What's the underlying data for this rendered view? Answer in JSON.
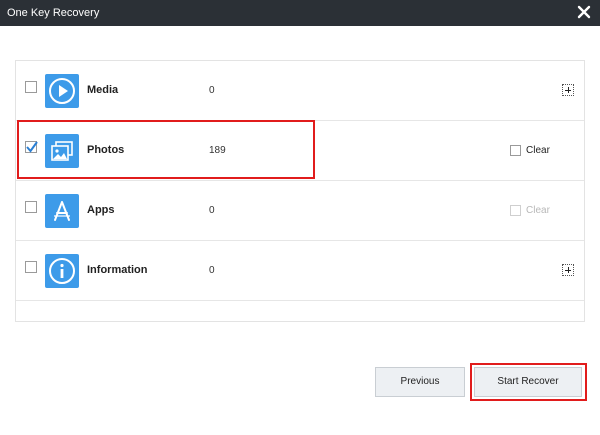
{
  "window": {
    "title": "One Key Recovery"
  },
  "items": [
    {
      "name": "Media",
      "count": "0",
      "checked": false,
      "icon": "media-play-icon",
      "action": "expand"
    },
    {
      "name": "Photos",
      "count": "189",
      "checked": true,
      "icon": "photos-icon",
      "action": "clear",
      "clear_label": "Clear",
      "clear_enabled": true
    },
    {
      "name": "Apps",
      "count": "0",
      "checked": false,
      "icon": "app-store-icon",
      "action": "clear",
      "clear_label": "Clear",
      "clear_enabled": false
    },
    {
      "name": "Information",
      "count": "0",
      "checked": false,
      "icon": "info-icon",
      "action": "expand"
    }
  ],
  "buttons": {
    "previous": "Previous",
    "start_recover": "Start Recover"
  },
  "colors": {
    "titlebar": "#2b3036",
    "icon_bg": "#3d9be9",
    "highlight": "#e11c1c",
    "check": "#2a7fd4"
  }
}
